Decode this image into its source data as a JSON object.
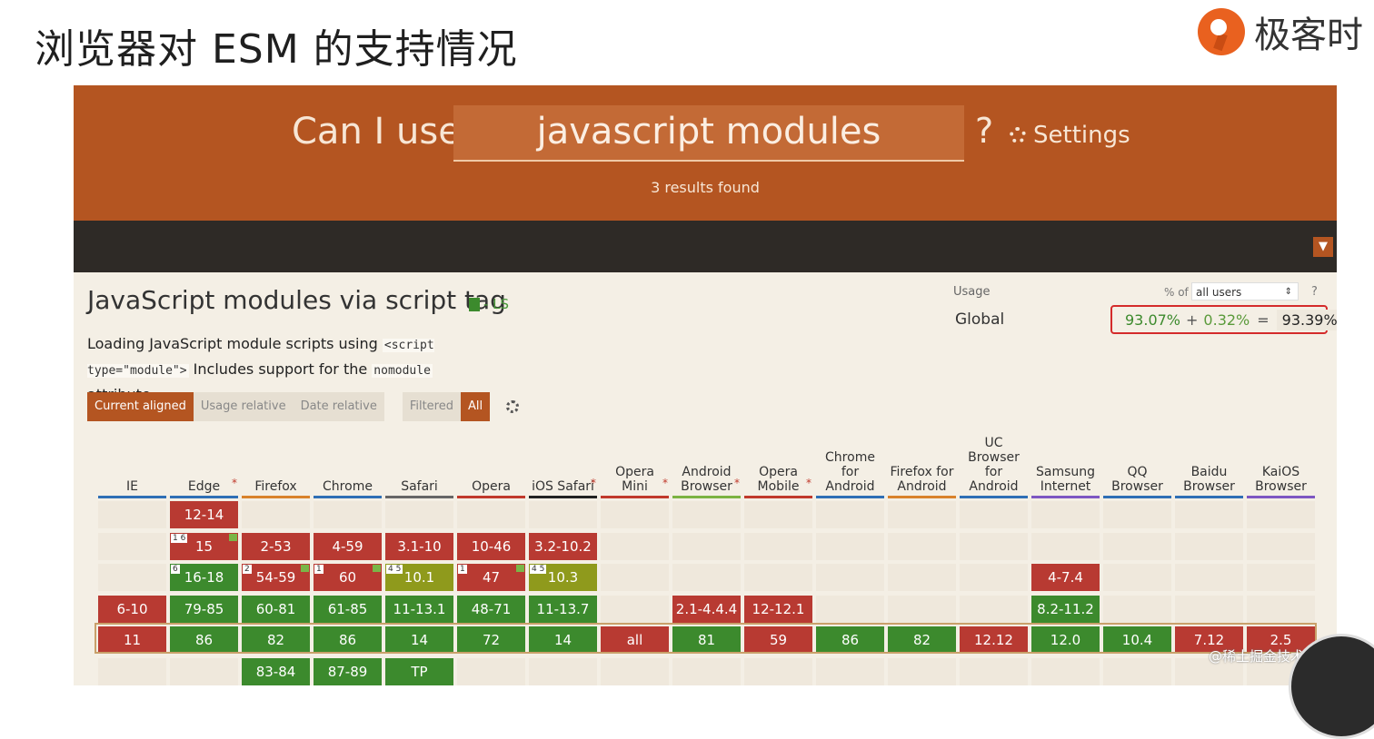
{
  "slide": {
    "title": "浏览器对 ESM 的支持情况",
    "brand": "极客时"
  },
  "caniuse": {
    "label": "Can I use",
    "search_value": "javascript modules",
    "question": "?",
    "settings": "Settings",
    "results": "3 results found"
  },
  "feature": {
    "title": "JavaScript modules via script tag",
    "badge": "- LS",
    "desc_1": "Loading JavaScript module scripts using",
    "code_1": "<script type=\"module\">",
    "desc_2": "Includes support for the",
    "code_2": "nomodule",
    "desc_3": "attribute."
  },
  "usage": {
    "label": "Usage",
    "region": "Global",
    "pct_of": "% of",
    "user_select": "all users",
    "help": "?",
    "supported": "93.07%",
    "plus": "+",
    "partial": "0.32%",
    "equals": "=",
    "total": "93.39%"
  },
  "controls": {
    "current_aligned": "Current aligned",
    "usage_relative": "Usage relative",
    "date_relative": "Date relative",
    "filtered": "Filtered",
    "all": "All"
  },
  "colors": {
    "header": "#b45521",
    "dark_bar": "#2e2a26",
    "no_support": "#b83a32",
    "support": "#3c8a2d",
    "partial": "#8f9a1c"
  },
  "browsers": [
    {
      "name": "IE",
      "star": "",
      "bar": "#2f6fb5",
      "cells": [
        [
          "",
          ""
        ],
        [
          "",
          ""
        ],
        [
          "",
          ""
        ],
        [
          "6-10",
          "ns"
        ],
        [
          "11",
          "ns"
        ],
        [
          "",
          ""
        ]
      ]
    },
    {
      "name": "Edge",
      "star": "*",
      "bar": "#2f6fb5",
      "cells": [
        [
          "12-14",
          "ns"
        ],
        [
          "15",
          "ns",
          "1 6",
          "f"
        ],
        [
          "16-18",
          "ys",
          "6",
          ""
        ],
        [
          "79-85",
          "ys"
        ],
        [
          "86",
          "ys"
        ],
        [
          "",
          ""
        ]
      ]
    },
    {
      "name": "Firefox",
      "star": "",
      "bar": "#d9822b",
      "cells": [
        [
          "",
          ""
        ],
        [
          "2-53",
          "ns"
        ],
        [
          "54-59",
          "ns",
          "2",
          "f"
        ],
        [
          "60-81",
          "ys"
        ],
        [
          "82",
          "ys"
        ],
        [
          "83-84",
          "ys"
        ]
      ]
    },
    {
      "name": "Chrome",
      "star": "",
      "bar": "#2f6fb5",
      "cells": [
        [
          "",
          ""
        ],
        [
          "4-59",
          "ns"
        ],
        [
          "60",
          "ns",
          "1",
          "f"
        ],
        [
          "61-85",
          "ys"
        ],
        [
          "86",
          "ys"
        ],
        [
          "87-89",
          "ys"
        ]
      ]
    },
    {
      "name": "Safari",
      "star": "",
      "bar": "#666666",
      "cells": [
        [
          "",
          ""
        ],
        [
          "3.1-10",
          "ns"
        ],
        [
          "10.1",
          "pt",
          "4 5",
          ""
        ],
        [
          "11-13.1",
          "ys"
        ],
        [
          "14",
          "ys"
        ],
        [
          "TP",
          "ys"
        ]
      ]
    },
    {
      "name": "Opera",
      "star": "",
      "bar": "#c0392b",
      "cells": [
        [
          "",
          ""
        ],
        [
          "10-46",
          "ns"
        ],
        [
          "47",
          "ns",
          "1",
          "f"
        ],
        [
          "48-71",
          "ys"
        ],
        [
          "72",
          "ys"
        ],
        [
          "",
          ""
        ]
      ]
    },
    {
      "name": "iOS Safari",
      "star": "*",
      "bar": "#222222",
      "cells": [
        [
          "",
          ""
        ],
        [
          "3.2-10.2",
          "ns"
        ],
        [
          "10.3",
          "pt",
          "4 5",
          ""
        ],
        [
          "11-13.7",
          "ys"
        ],
        [
          "14",
          "ys"
        ],
        [
          "",
          ""
        ]
      ]
    },
    {
      "name": "Opera Mini",
      "star": "*",
      "bar": "#c0392b",
      "cells": [
        [
          "",
          ""
        ],
        [
          "",
          ""
        ],
        [
          "",
          ""
        ],
        [
          "",
          ""
        ],
        [
          "all",
          "ns"
        ],
        [
          "",
          ""
        ]
      ]
    },
    {
      "name": "Android Browser",
      "star": "*",
      "bar": "#7cb342",
      "cells": [
        [
          "",
          ""
        ],
        [
          "",
          ""
        ],
        [
          "",
          ""
        ],
        [
          "2.1-4.4.4",
          "ns"
        ],
        [
          "81",
          "ys"
        ],
        [
          "",
          ""
        ]
      ]
    },
    {
      "name": "Opera Mobile",
      "star": "*",
      "bar": "#c0392b",
      "cells": [
        [
          "",
          ""
        ],
        [
          "",
          ""
        ],
        [
          "",
          ""
        ],
        [
          "12-12.1",
          "ns"
        ],
        [
          "59",
          "ns"
        ],
        [
          "",
          ""
        ]
      ]
    },
    {
      "name": "Chrome for Android",
      "star": "",
      "bar": "#2f6fb5",
      "cells": [
        [
          "",
          ""
        ],
        [
          "",
          ""
        ],
        [
          "",
          ""
        ],
        [
          "",
          ""
        ],
        [
          "86",
          "ys"
        ],
        [
          "",
          ""
        ]
      ]
    },
    {
      "name": "Firefox for Android",
      "star": "",
      "bar": "#d9822b",
      "cells": [
        [
          "",
          ""
        ],
        [
          "",
          ""
        ],
        [
          "",
          ""
        ],
        [
          "",
          ""
        ],
        [
          "82",
          "ys"
        ],
        [
          "",
          ""
        ]
      ]
    },
    {
      "name": "UC Browser for Android",
      "star": "",
      "bar": "#2f6fb5",
      "cells": [
        [
          "",
          ""
        ],
        [
          "",
          ""
        ],
        [
          "",
          ""
        ],
        [
          "",
          ""
        ],
        [
          "12.12",
          "ns"
        ],
        [
          "",
          ""
        ]
      ]
    },
    {
      "name": "Samsung Internet",
      "star": "",
      "bar": "#7e57c2",
      "cells": [
        [
          "",
          ""
        ],
        [
          "",
          ""
        ],
        [
          "4-7.4",
          "ns"
        ],
        [
          "8.2-11.2",
          "ys"
        ],
        [
          "12.0",
          "ys"
        ],
        [
          "",
          ""
        ]
      ]
    },
    {
      "name": "QQ Browser",
      "star": "",
      "bar": "#2f6fb5",
      "cells": [
        [
          "",
          ""
        ],
        [
          "",
          ""
        ],
        [
          "",
          ""
        ],
        [
          "",
          ""
        ],
        [
          "10.4",
          "ys"
        ],
        [
          "",
          ""
        ]
      ]
    },
    {
      "name": "Baidu Browser",
      "star": "",
      "bar": "#2f6fb5",
      "cells": [
        [
          "",
          ""
        ],
        [
          "",
          ""
        ],
        [
          "",
          ""
        ],
        [
          "",
          ""
        ],
        [
          "7.12",
          "ns"
        ],
        [
          "",
          ""
        ]
      ]
    },
    {
      "name": "KaiOS Browser",
      "star": "",
      "bar": "#7e57c2",
      "cells": [
        [
          "",
          ""
        ],
        [
          "",
          ""
        ],
        [
          "",
          ""
        ],
        [
          "",
          ""
        ],
        [
          "2.5",
          "ns"
        ],
        [
          "",
          ""
        ]
      ]
    }
  ],
  "watermark": "@稀土掘金技术社区"
}
